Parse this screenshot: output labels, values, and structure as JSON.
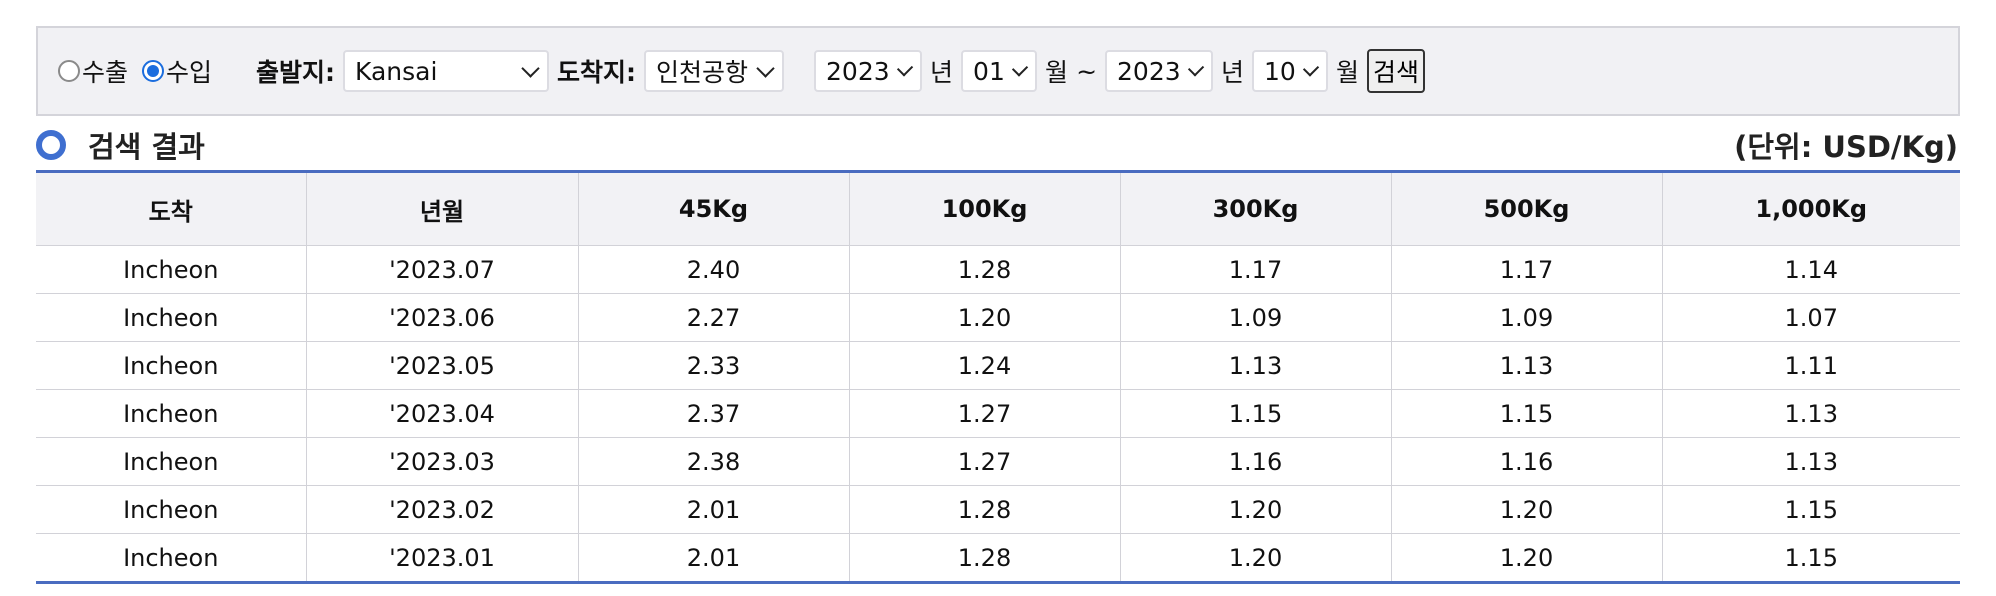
{
  "filters": {
    "radios": [
      {
        "label": "수출",
        "checked": false
      },
      {
        "label": "수입",
        "checked": true
      }
    ],
    "origin_label": "출발지:",
    "origin_value": "Kansai",
    "destination_label": "도착지:",
    "destination_value": "인천공항",
    "start_year": "2023",
    "year_unit": "년",
    "start_month": "01",
    "month_unit": "월",
    "range_sep": "~",
    "end_year": "2023",
    "end_month": "10",
    "search_label": "검색"
  },
  "results": {
    "title": "검색 결과",
    "unit_note": "(단위: USD/Kg)",
    "columns": [
      "도착",
      "년월",
      "45Kg",
      "100Kg",
      "300Kg",
      "500Kg",
      "1,000Kg"
    ],
    "rows": [
      [
        "Incheon",
        "'2023.07",
        "2.40",
        "1.28",
        "1.17",
        "1.17",
        "1.14"
      ],
      [
        "Incheon",
        "'2023.06",
        "2.27",
        "1.20",
        "1.09",
        "1.09",
        "1.07"
      ],
      [
        "Incheon",
        "'2023.05",
        "2.33",
        "1.24",
        "1.13",
        "1.13",
        "1.11"
      ],
      [
        "Incheon",
        "'2023.04",
        "2.37",
        "1.27",
        "1.15",
        "1.15",
        "1.13"
      ],
      [
        "Incheon",
        "'2023.03",
        "2.38",
        "1.27",
        "1.16",
        "1.16",
        "1.13"
      ],
      [
        "Incheon",
        "'2023.02",
        "2.01",
        "1.28",
        "1.20",
        "1.20",
        "1.15"
      ],
      [
        "Incheon",
        "'2023.01",
        "2.01",
        "1.28",
        "1.20",
        "1.20",
        "1.15"
      ]
    ]
  },
  "colors": {
    "accent": "#4a6cc0",
    "radio_active": "#1b6dde",
    "bar_bg": "#f1f1f4"
  }
}
